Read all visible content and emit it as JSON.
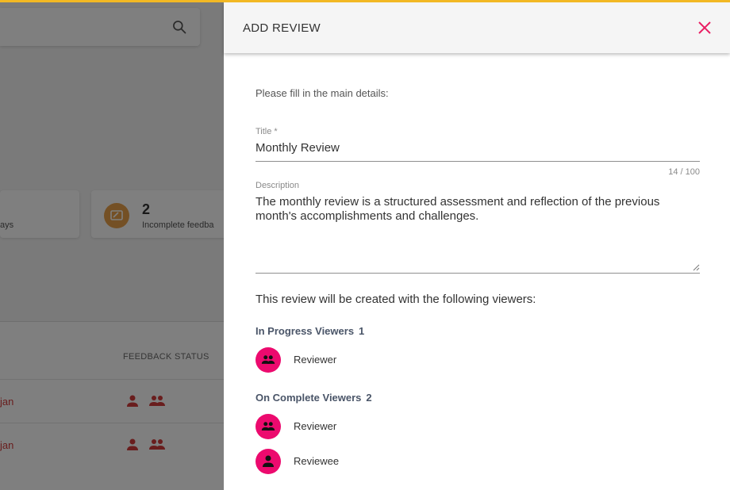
{
  "background": {
    "card1_text": "ays",
    "card2_number": "2",
    "card2_label": "Incomplete feedba",
    "table_header": "FEEDBACK STATUS",
    "rows": [
      {
        "name": "jan"
      },
      {
        "name": "jan"
      }
    ]
  },
  "drawer": {
    "title": "ADD REVIEW",
    "intro": "Please fill in the main details:",
    "title_field": {
      "label": "Title *",
      "value": "Monthly Review",
      "counter": "14 / 100"
    },
    "description_field": {
      "label": "Description",
      "value": "The monthly review is a structured assessment and reflection of the previous month's accomplishments and challenges."
    },
    "viewers_intro": "This review will be created with the following viewers:",
    "in_progress": {
      "label": "In Progress Viewers",
      "count": "1",
      "viewers": [
        {
          "name": "Reviewer",
          "icon": "group-icon"
        }
      ]
    },
    "on_complete": {
      "label": "On Complete Viewers",
      "count": "2",
      "viewers": [
        {
          "name": "Reviewer",
          "icon": "group-icon"
        },
        {
          "name": "Reviewee",
          "icon": "person-icon"
        }
      ]
    }
  },
  "colors": {
    "accent": "#ec0a6e",
    "top_bar": "#f2b824",
    "close": "#e91e63"
  }
}
